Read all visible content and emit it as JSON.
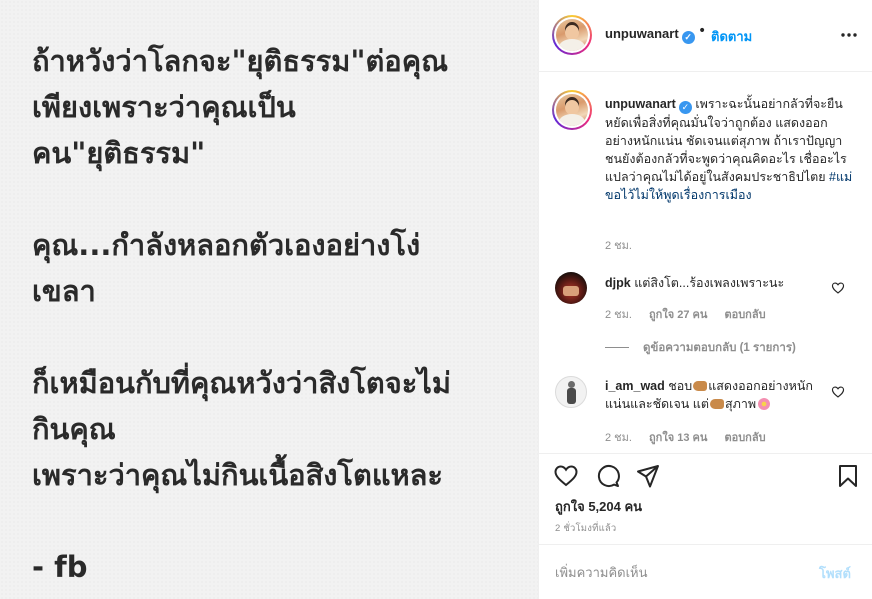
{
  "post_image": {
    "text": "ถ้าหวังว่าโลกจะ\"ยุติธรรม\"ต่อคุณ\nเพียงเพราะว่าคุณเป็น\nคน\"ยุติธรรม\"\n\nคุณ...กำลังหลอกตัวเองอย่างโง่\nเขลา\n\nก็เหมือนกับที่คุณหวังว่าสิงโตจะไม่\nกินคุณ\nเพราะว่าคุณไม่กินเนื้อสิงโตแหละ\n\n- fb"
  },
  "header": {
    "username": "unpuwanart",
    "verified": true,
    "separator": "•",
    "follow_label": "ติดตาม",
    "more_icon": "more-horizontal-icon"
  },
  "caption": {
    "username": "unpuwanart",
    "text": "เพราะฉะนั้นอย่ากลัวที่จะยืนหยัดเพื่อสิ่งที่คุณมั่นใจว่าถูกต้อง แสดงออกอย่างหนักแน่น ชัดเจนแต่สุภาพ ถ้าเราปัญญาชนยังต้องกลัวที่จะพูดว่าคุณคิดอะไร เชื่ออะไร แปลว่าคุณไม่ได้อยู่ในสังคมประชาธิปไตย",
    "hashtag": "#แม่ขอไว้ไม่ให้พูดเรื่องการเมือง",
    "time": "2 ชม."
  },
  "comments": [
    {
      "username": "djpk",
      "text": "แต่สิงโต...ร้องเพลงเพราะนะ",
      "time": "2 ชม.",
      "likes": "ถูกใจ 27 คน",
      "reply_label": "ตอบกลับ",
      "view_replies": "ดูข้อความตอบกลับ (1 รายการ)"
    },
    {
      "username": "i_am_wad",
      "text_before": "ชอบ",
      "text_mid1": "แสดงออกอย่างหนักแน่นและชัดเจน แต่",
      "text_mid2": "สุภาพ",
      "time": "2 ชม.",
      "likes": "ถูกใจ 13 คน",
      "reply_label": "ตอบกลับ"
    }
  ],
  "actions": {
    "like_icon": "heart-icon",
    "comment_icon": "comment-icon",
    "share_icon": "send-icon",
    "save_icon": "bookmark-icon",
    "likes_count": "ถูกใจ 5,204 คน",
    "post_time": "2 ชั่วโมงที่แล้ว"
  },
  "add_comment": {
    "placeholder": "เพิ่มความคิดเห็น",
    "post_label": "โพสต์"
  },
  "colors": {
    "link_blue": "#0095f6",
    "verified_blue": "#3897f0",
    "muted": "#8e8e8e",
    "post_disabled": "#b2dffc"
  }
}
